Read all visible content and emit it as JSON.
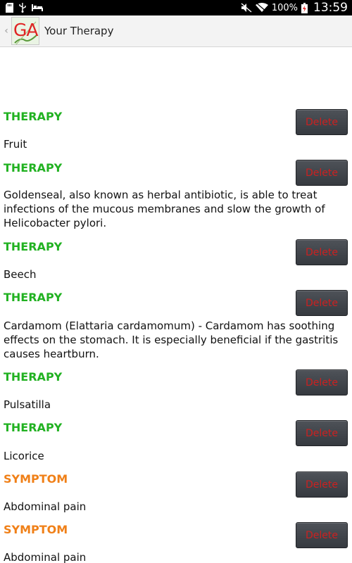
{
  "status_bar": {
    "battery": "100%",
    "time": "13:59",
    "icons": [
      "sd-card-icon",
      "usb-icon",
      "bed-icon",
      "mute-icon",
      "wifi-icon",
      "battery-icon"
    ]
  },
  "action_bar": {
    "logo_text": "GA",
    "title": "Your Therapy"
  },
  "items": [
    {
      "type": "THERAPY",
      "text": "Fruit",
      "delete_label": "Delete"
    },
    {
      "type": "THERAPY",
      "text": "Goldenseal, also known as herbal antibiotic, is able to treat infections of the mucous membranes and slow the growth of Helicobacter pylori.",
      "delete_label": "Delete"
    },
    {
      "type": "THERAPY",
      "text": "Beech",
      "delete_label": "Delete"
    },
    {
      "type": "THERAPY",
      "text": "Cardamom (Elattaria cardamomum) - Cardamom has soothing effects on the stomach. It is especially beneficial if the gastritis causes heartburn.",
      "delete_label": "Delete"
    },
    {
      "type": "THERAPY",
      "text": "Pulsatilla",
      "delete_label": "Delete"
    },
    {
      "type": "THERAPY",
      "text": "Licorice",
      "delete_label": "Delete"
    },
    {
      "type": "SYMPTOM",
      "text": "Abdominal pain",
      "delete_label": "Delete"
    },
    {
      "type": "SYMPTOM",
      "text": "Abdominal pain",
      "delete_label": "Delete"
    }
  ],
  "colors": {
    "therapy": "#22b222",
    "symptom": "#f08018",
    "delete_text": "#cc2020"
  }
}
